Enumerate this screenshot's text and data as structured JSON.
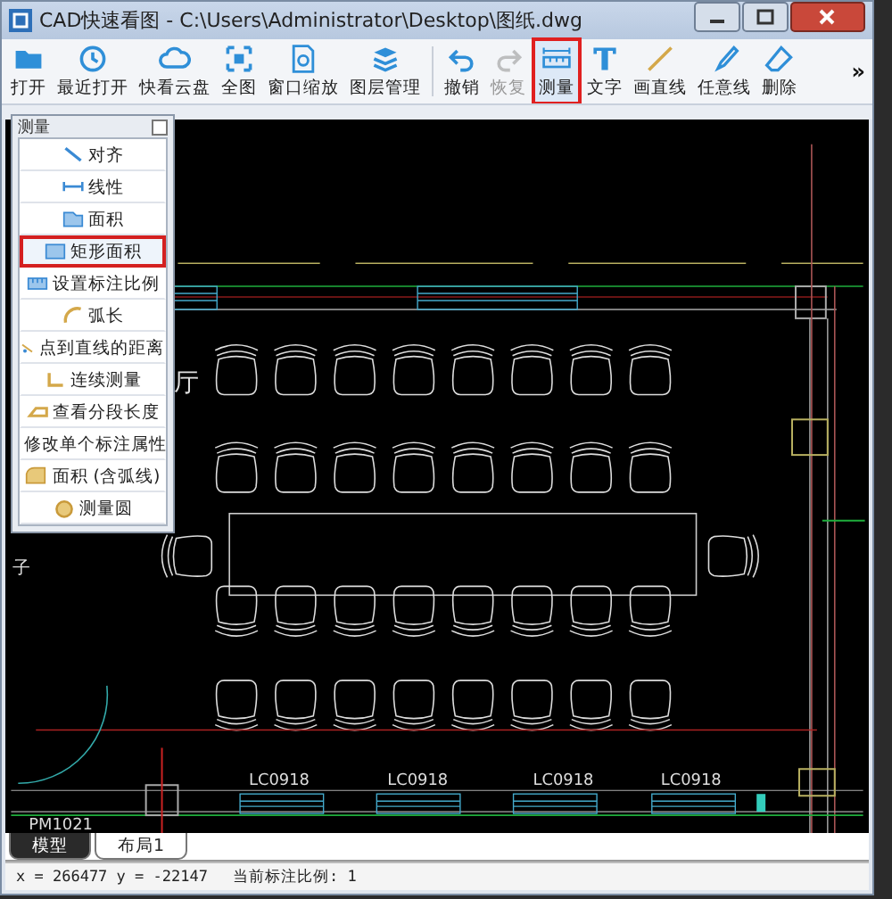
{
  "window": {
    "title": "CAD快速看图 - C:\\Users\\Administrator\\Desktop\\图纸.dwg"
  },
  "toolbar": {
    "tools": [
      {
        "label": "打开",
        "disabled": false,
        "selected": false
      },
      {
        "label": "最近打开",
        "disabled": false,
        "selected": false
      },
      {
        "label": "快看云盘",
        "disabled": false,
        "selected": false
      },
      {
        "label": "全图",
        "disabled": false,
        "selected": false
      },
      {
        "label": "窗口缩放",
        "disabled": false,
        "selected": false
      },
      {
        "label": "图层管理",
        "disabled": false,
        "selected": false
      },
      {
        "label": "撤销",
        "disabled": false,
        "selected": false
      },
      {
        "label": "恢复",
        "disabled": true,
        "selected": false
      },
      {
        "label": "测量",
        "disabled": false,
        "selected": true
      },
      {
        "label": "文字",
        "disabled": false,
        "selected": false
      },
      {
        "label": "画直线",
        "disabled": false,
        "selected": false
      },
      {
        "label": "任意线",
        "disabled": false,
        "selected": false
      },
      {
        "label": "删除",
        "disabled": false,
        "selected": false
      }
    ],
    "more": "»"
  },
  "measure_panel": {
    "title": "测量",
    "items": [
      {
        "label": "对齐",
        "selected": false
      },
      {
        "label": "线性",
        "selected": false
      },
      {
        "label": "面积",
        "selected": false
      },
      {
        "label": "矩形面积",
        "selected": true
      },
      {
        "label": "设置标注比例",
        "selected": false
      },
      {
        "label": "弧长",
        "selected": false
      },
      {
        "label": "点到直线的距离",
        "selected": false
      },
      {
        "label": "连续测量",
        "selected": false
      },
      {
        "label": "查看分段长度",
        "selected": false
      },
      {
        "label": "修改单个标注属性",
        "selected": false
      },
      {
        "label": "面积 (含弧线)",
        "selected": false
      },
      {
        "label": "测量圆",
        "selected": false
      }
    ]
  },
  "drawing": {
    "room_label": "厅",
    "edge_label": "子",
    "window_labels": [
      "LC0918",
      "LC0918",
      "LC0918",
      "LC0918"
    ],
    "door_label": "PM1021"
  },
  "tabs": [
    {
      "label": "模型",
      "selected": true
    },
    {
      "label": "布局1",
      "selected": false
    }
  ],
  "status_bar": {
    "coordinates": "x = 266477 y = -22147",
    "scale": "当前标注比例: 1"
  }
}
